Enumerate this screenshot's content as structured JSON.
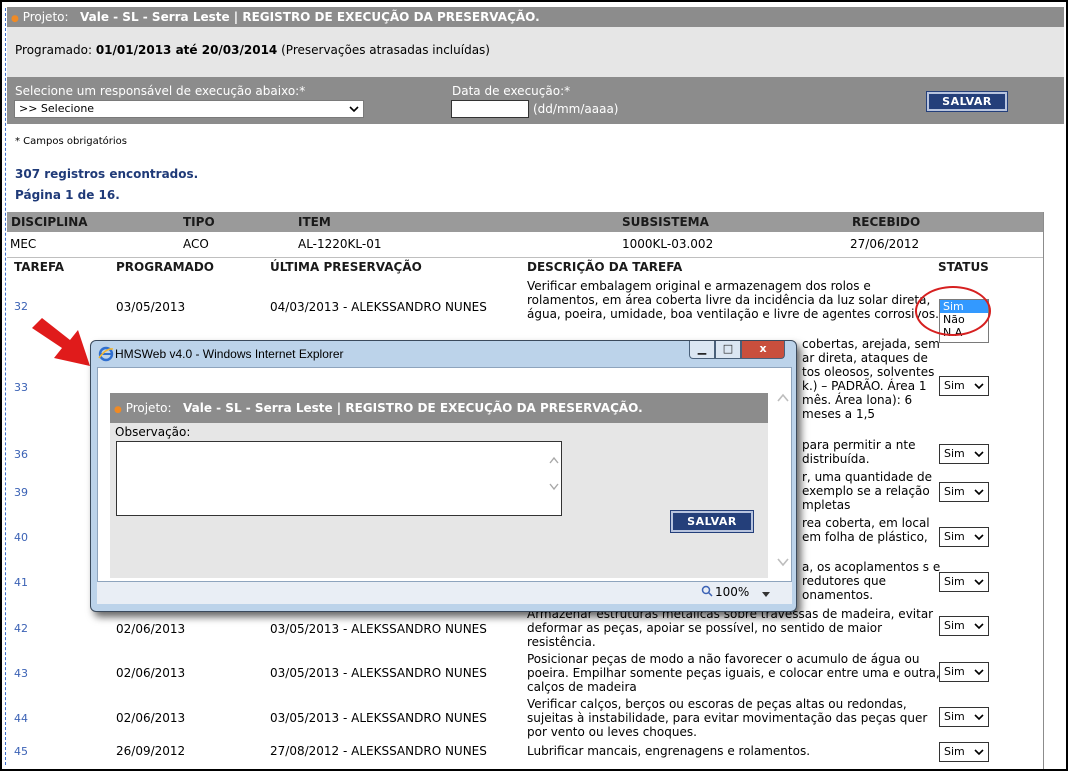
{
  "header": {
    "project_label": "Projeto:",
    "project_title": "Vale - SL - Serra Leste | REGISTRO DE EXECUÇÃO DA PRESERVAÇÃO.",
    "programado_label": "Programado:",
    "programado_range": "01/01/2013 até 20/03/2014",
    "programado_note": "(Preservações atrasadas incluídas)"
  },
  "form": {
    "responsavel_label": "Selecione um responsável de execução abaixo:*",
    "responsavel_value": ">> Selecione",
    "data_label": "Data de execução:*",
    "data_value": "",
    "data_hint": "(dd/mm/aaaa)",
    "save_label": "SALVAR",
    "required_note": "* Campos obrigatórios"
  },
  "results": {
    "count_text": "307 registros encontrados.",
    "page_text": "Página 1 de 16."
  },
  "info_table": {
    "headers": [
      "DISCIPLINA",
      "TIPO",
      "ITEM",
      "SUBSISTEMA",
      "RECEBIDO"
    ],
    "row": [
      "MEC",
      "ACO",
      "AL-1220KL-01",
      "1000KL-03.002",
      "27/06/2012"
    ]
  },
  "task_table": {
    "headers": [
      "TAREFA",
      "PROGRAMADO",
      "ÚLTIMA PRESERVAÇÃO",
      "DESCRIÇÃO DA TAREFA",
      "STATUS"
    ],
    "rows": [
      {
        "num": "32",
        "prog": "03/05/2013",
        "ultima": "04/03/2013 - ALEKSSANDRO NUNES",
        "desc": "Verificar embalagem original e armazenagem dos rolos e rolamentos, em área coberta livre da incidência da luz solar direta, água, poeira, umidade, boa ventilação e livre de agentes corrosivos.",
        "status": "Sim"
      },
      {
        "num": "33",
        "prog": "",
        "ultima": "",
        "desc": "cobertas, arejada, sem ar direta, ataques de tos oleosos, solventes k.) – PADRÃO. Área 1 mês. Área lona): 6 meses a 1,5",
        "status": "Sim"
      },
      {
        "num": "36",
        "prog": "",
        "ultima": "",
        "desc": "para permitir a nte distribuída.",
        "status": "Sim"
      },
      {
        "num": "39",
        "prog": "",
        "ultima": "",
        "desc": "r, uma quantidade de exemplo se a relação mpletas",
        "status": "Sim"
      },
      {
        "num": "40",
        "prog": "",
        "ultima": "",
        "desc": "rea coberta, em local em folha de plástico,",
        "status": "Sim"
      },
      {
        "num": "41",
        "prog": "",
        "ultima": "",
        "desc": "a, os acoplamentos s e redutores que onamentos.",
        "status": "Sim"
      },
      {
        "num": "42",
        "prog": "02/06/2013",
        "ultima": "03/05/2013 - ALEKSSANDRO NUNES",
        "desc": "Armazenar estruturas metálicas sobre travessas de madeira, evitar deformar as peças, apoiar se possível, no sentido de maior resistência.",
        "status": "Sim"
      },
      {
        "num": "43",
        "prog": "02/06/2013",
        "ultima": "03/05/2013 - ALEKSSANDRO NUNES",
        "desc": "Posicionar peças de modo a não favorecer o acumulo de água ou poeira. Empilhar somente peças iguais, e colocar entre uma e outra, calços de madeira",
        "status": "Sim"
      },
      {
        "num": "44",
        "prog": "02/06/2013",
        "ultima": "03/05/2013 - ALEKSSANDRO NUNES",
        "desc": "Verificar calços, berços ou escoras de peças altas ou redondas, sujeitas à instabilidade, para evitar movimentação das peças quer por vento ou leves choques.",
        "status": "Sim"
      },
      {
        "num": "45",
        "prog": "26/09/2012",
        "ultima": "27/08/2012 - ALEKSSANDRO NUNES",
        "desc": "Lubrificar mancais, engrenagens e rolamentos.",
        "status": "Sim"
      }
    ]
  },
  "status_dropdown": {
    "options": [
      "Sim",
      "Não",
      "N.A"
    ],
    "highlighted": "Sim"
  },
  "popup": {
    "window_title": "HMSWeb v4.0 - Windows Internet Explorer",
    "project_label": "Projeto:",
    "project_title": "Vale - SL - Serra Leste | REGISTRO DE EXECUÇÃO DA PRESERVAÇÃO.",
    "obs_label": "Observação:",
    "save_label": "SALVAR",
    "zoom": "100%",
    "close_glyph": "x",
    "min_glyph": "▁",
    "max_glyph": "□"
  },
  "colors": {
    "bar_grey": "#8c8c8c",
    "light_grey": "#e6e6e6",
    "button_navy": "#243f7a",
    "link_blue": "#3b62b5",
    "highlight_circle": "#d62020",
    "arrow_red": "#e01b1b"
  }
}
